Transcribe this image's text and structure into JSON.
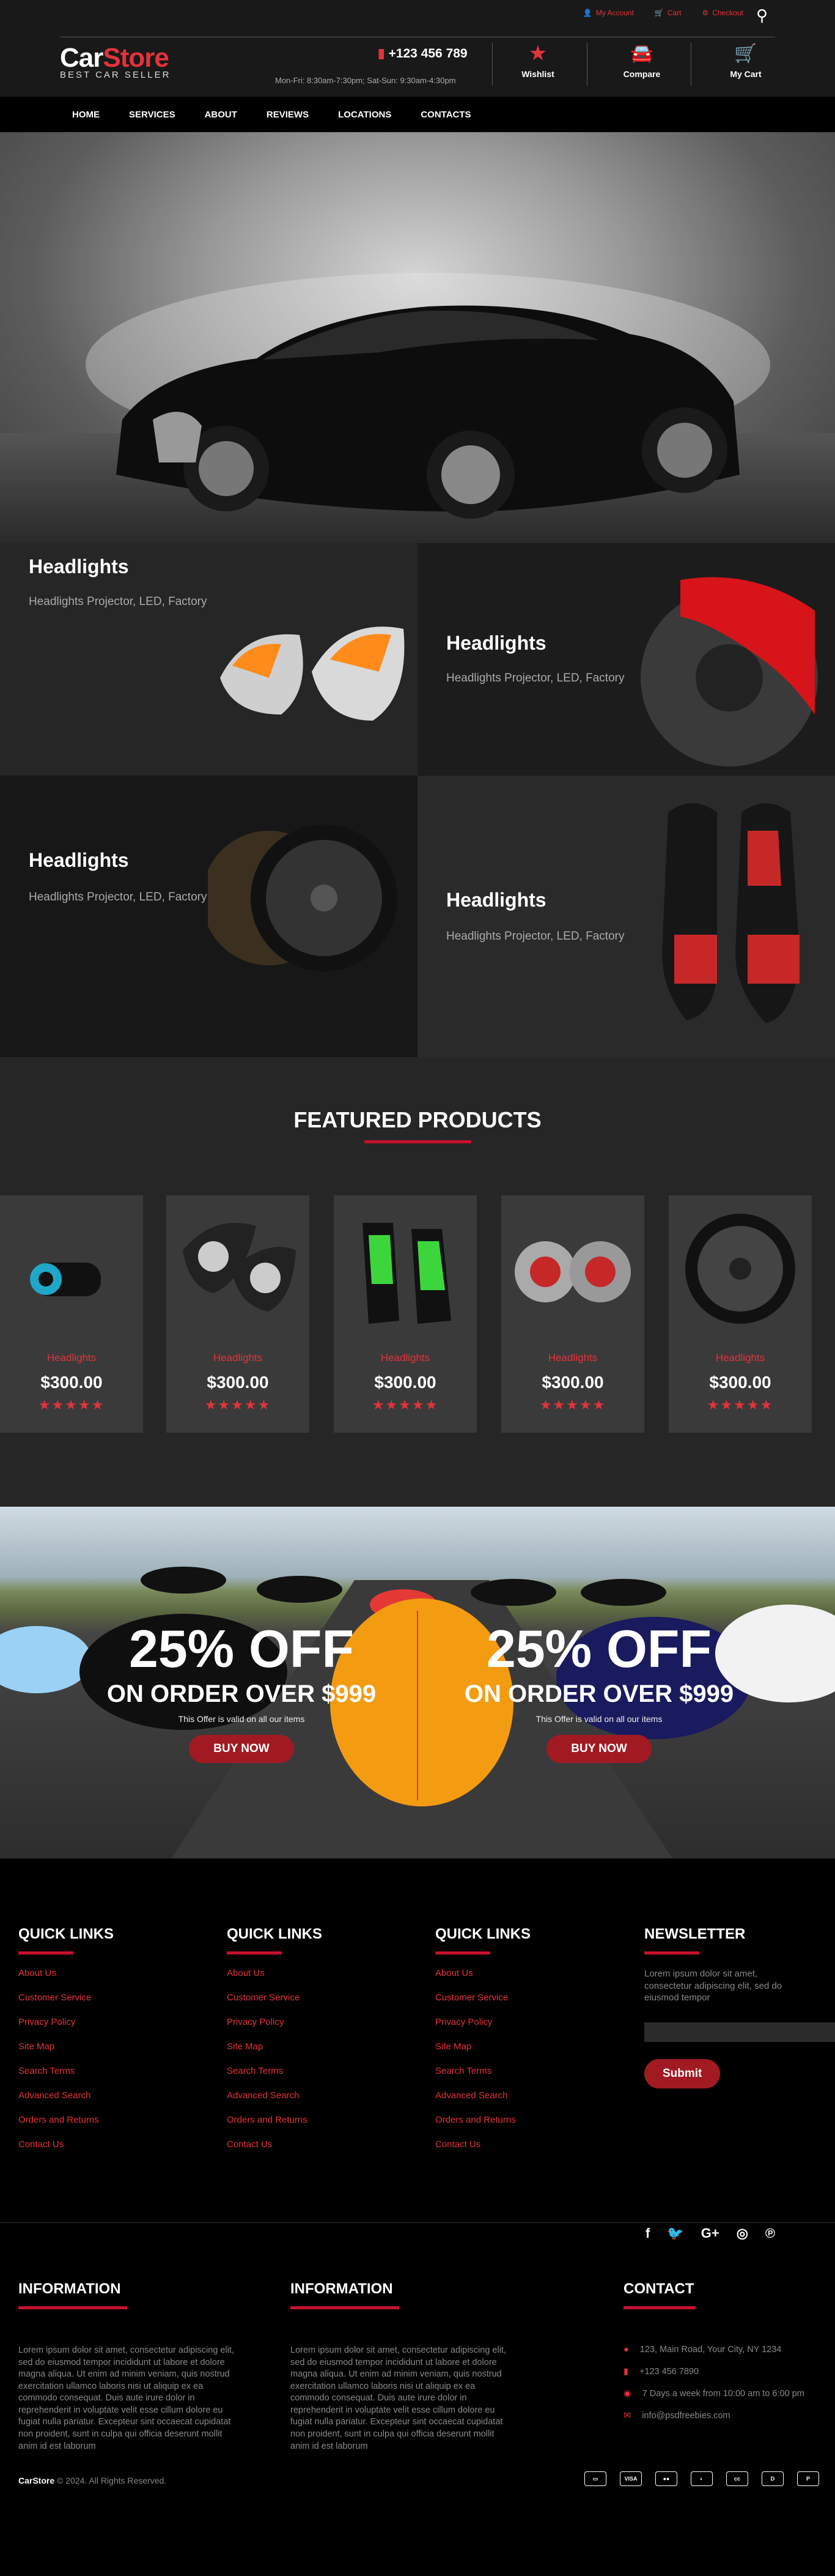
{
  "topbar": {
    "account": "My Account",
    "cart": "Cart",
    "checkout": "Checkout"
  },
  "logo": {
    "car": "Car",
    "store": "Store",
    "tagline": "BEST CAR SELLER"
  },
  "contact": {
    "phone": "+123 456 789",
    "hours": "Mon-Fri: 8:30am-7:30pm; Sat-Sun: 9:30am-4:30pm"
  },
  "header_buttons": {
    "wishlist": "Wishlist",
    "compare": "Compare",
    "cart": "My Cart"
  },
  "nav": [
    "HOME",
    "SERVICES",
    "ABOUT",
    "REVIEWS",
    "LOCATIONS",
    "CONTACTS"
  ],
  "categories": [
    {
      "title": "Headlights",
      "desc": "Headlights Projector, LED, Factory"
    },
    {
      "title": "Headlights",
      "desc": "Headlights Projector, LED, Factory"
    },
    {
      "title": "Headlights",
      "desc": "Headlights Projector, LED, Factory"
    },
    {
      "title": "Headlights",
      "desc": "Headlights Projector, LED, Factory"
    }
  ],
  "featured": {
    "title": "FEATURED PRODUCTS",
    "products": [
      {
        "name": "Headlights",
        "price": "$300.00",
        "stars": "★★★★★"
      },
      {
        "name": "Headlights",
        "price": "$300.00",
        "stars": "★★★★★"
      },
      {
        "name": "Headlights",
        "price": "$300.00",
        "stars": "★★★★★"
      },
      {
        "name": "Headlights",
        "price": "$300.00",
        "stars": "★★★★★"
      },
      {
        "name": "Headlights",
        "price": "$300.00",
        "stars": "★★★★★"
      }
    ]
  },
  "offers": [
    {
      "big": "25% OFF",
      "sub": "ON ORDER OVER $999",
      "small": "This Offer is valid on all our items",
      "button": "BUY NOW"
    },
    {
      "big": "25% OFF",
      "sub": "ON ORDER OVER $999",
      "small": "This Offer is valid on all our items",
      "button": "BUY NOW"
    }
  ],
  "quick_links": {
    "title": "QUICK LINKS",
    "items": [
      "About Us",
      "Customer Service",
      "Privacy Policy",
      "Site Map",
      "Search Terms",
      "Advanced Search",
      "Orders and Returns",
      "Contact Us"
    ]
  },
  "newsletter": {
    "title": "NEWSLETTER",
    "text": "Lorem ipsum dolor sit amet, consectetur adipiscing elit, sed do eiusmod tempor",
    "button": "Submit"
  },
  "information": {
    "title": "INFORMATION",
    "text": "Lorem ipsum dolor sit amet, consectetur adipiscing elit, sed do eiusmod tempor incididunt ut labore et dolore magna aliqua. Ut enim ad minim veniam, quis nostrud exercitation ullamco laboris nisi ut aliquip ex ea commodo consequat. Duis aute irure dolor in reprehenderit in voluptate velit esse cillum dolore eu fugiat nulla pariatur. Excepteur sint occaecat cupidatat non proident, sunt in culpa qui officia deserunt mollit anim id est laborum"
  },
  "contact_block": {
    "title": "CONTACT",
    "address": "123, Main Road, Your City, NY 1234",
    "phone": "+123 456 7890",
    "hours": "7 Days a week from 10:00 am to 6:00 pm",
    "email": "info@psdfreebies.com"
  },
  "copyright": {
    "brand": "CarStore",
    "text": "© 2024. All Rights Reserved."
  }
}
